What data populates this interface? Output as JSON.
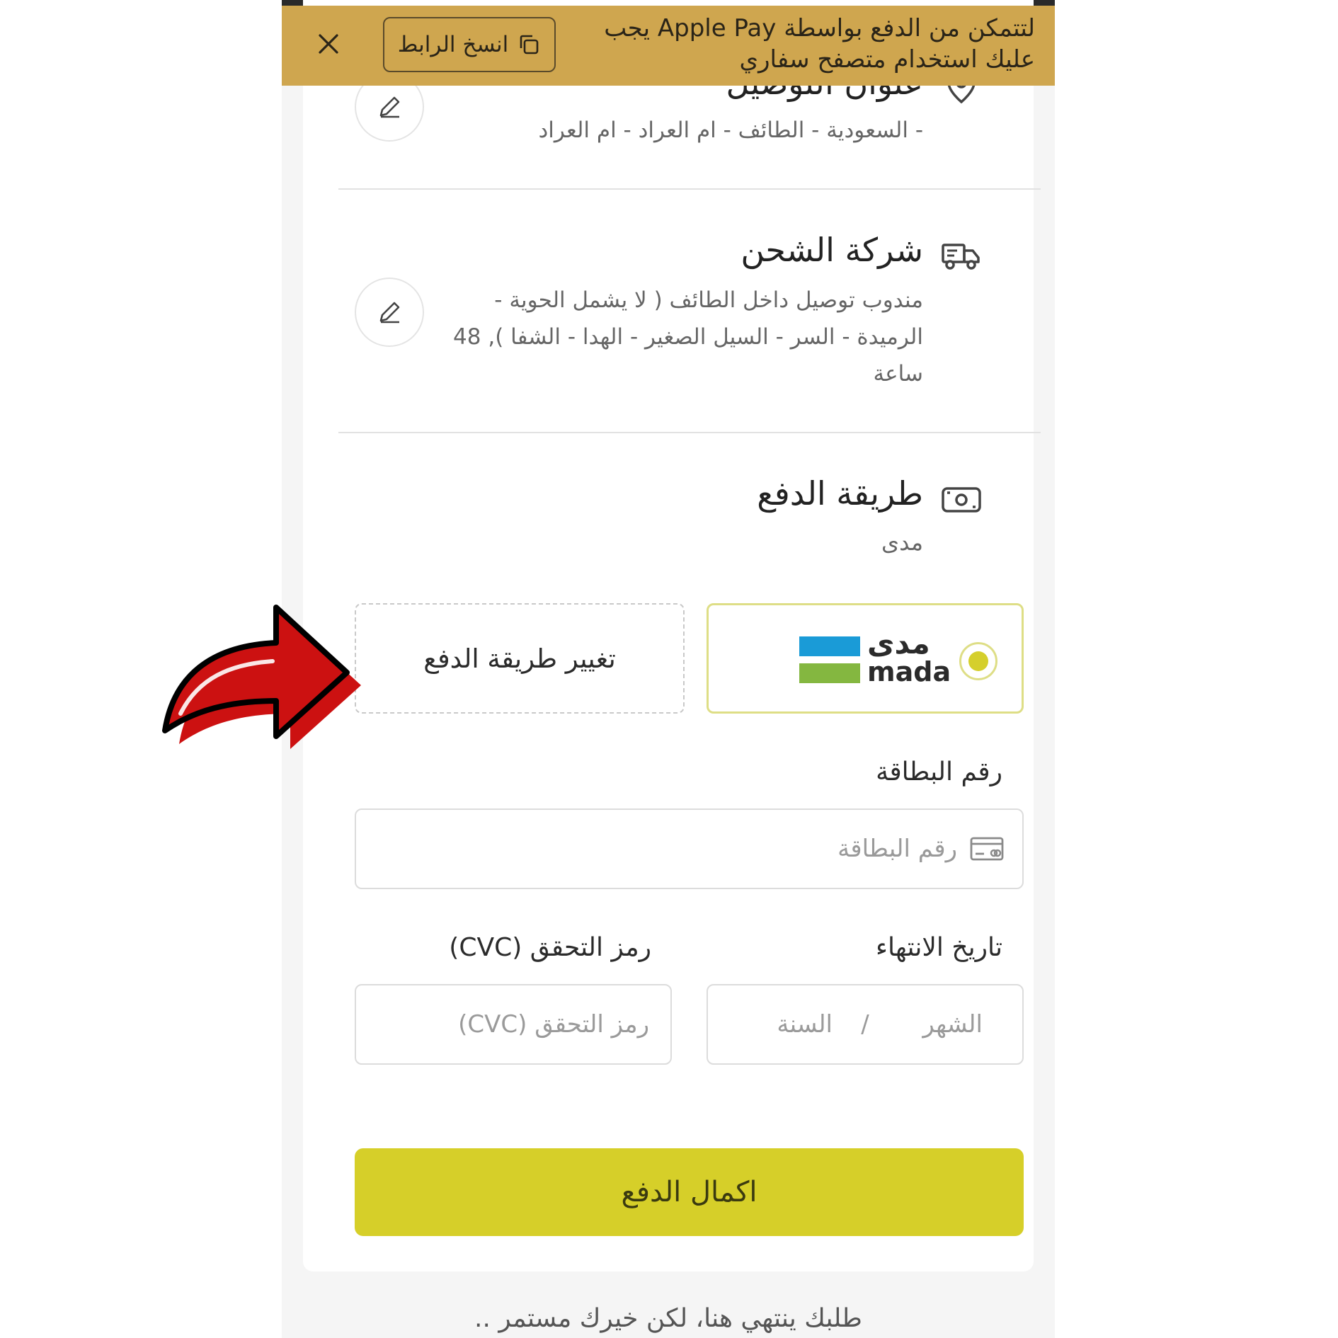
{
  "banner": {
    "text": "لتتمكن من الدفع بواسطة Apple Pay يجب عليك استخدام متصفح سفاري",
    "copy_label": "انسخ الرابط"
  },
  "address": {
    "title": "عنوان التوصيل",
    "body": "- السعودية - الطائف - ام العراد - ام العراد"
  },
  "shipping": {
    "title": "شركة الشحن",
    "body": "مندوب توصيل داخل الطائف ( لا يشمل الحوية - الرميدة - السر - السيل الصغير - الهدا - الشفا ), 48 ساعة"
  },
  "payment": {
    "title": "طريقة الدفع",
    "method": "مدى",
    "mada_ar": "مدى",
    "mada_en": "mada",
    "change_label": "تغيير طريقة الدفع"
  },
  "form": {
    "card_number_label": "رقم البطاقة",
    "card_number_placeholder": "رقم البطاقة",
    "expiry_label": "تاريخ الانتهاء",
    "month_placeholder": "الشهر",
    "separator": "/",
    "year_placeholder": "السنة",
    "cvc_label": "رمز التحقق (CVC)",
    "cvc_placeholder": "رمز التحقق (CVC)"
  },
  "submit_label": "اكمال الدفع",
  "footer": "طلبك ينتهي هنا، لكن خيرك مستمر ..",
  "colors": {
    "banner": "#cfa64f",
    "accent": "#d6cf29",
    "mada_blue": "#1a9bd7",
    "mada_green": "#84b740",
    "arrow_red": "#cc1111"
  },
  "icons": {
    "close": "close-icon",
    "copy": "copy-icon",
    "location": "location-pin-icon",
    "truck": "truck-icon",
    "cash": "cash-icon",
    "edit": "pencil-icon",
    "card": "credit-card-icon",
    "arrow": "curved-arrow-icon"
  }
}
